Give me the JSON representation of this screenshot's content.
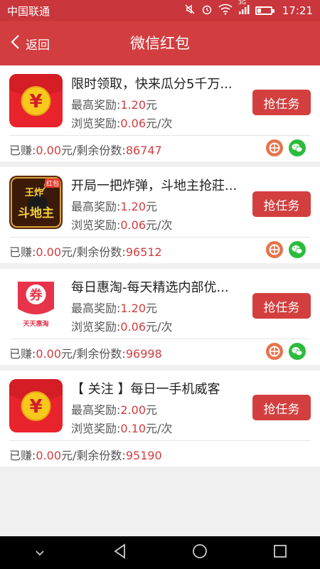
{
  "status_bar": {
    "carrier": "中国联通",
    "network": "3G",
    "time": "17:21"
  },
  "header": {
    "back_label": "返回",
    "title": "微信红包"
  },
  "tasks": [
    {
      "title": "限时领取，快来瓜分5千万...",
      "max_reward_label": "最高奖励:",
      "max_reward_value": "1.20",
      "max_reward_unit": "元",
      "view_reward_label": "浏览奖励:",
      "view_reward_value": "0.06",
      "view_reward_unit": "元/次",
      "earned_label": "已赚:",
      "earned_value": "0.00",
      "remaining_label": "元/剩余份数:",
      "remaining_value": "86747",
      "button_label": "抢任务",
      "icon": "yuan-coin-icon",
      "shares": true
    },
    {
      "title": "开局一把炸弹，斗地主抢莊...",
      "max_reward_label": "最高奖励:",
      "max_reward_value": "1.20",
      "max_reward_unit": "元",
      "view_reward_label": "浏览奖励:",
      "view_reward_value": "0.06",
      "view_reward_unit": "元/次",
      "earned_label": "已赚:",
      "earned_value": "0.00",
      "remaining_label": "元/剩余份数:",
      "remaining_value": "96512",
      "button_label": "抢任务",
      "icon": "doudizhu-game-icon",
      "logo_text": "王炸斗地主",
      "shares": true
    },
    {
      "title": "每日惠淘-每天精选内部优...",
      "max_reward_label": "最高奖励:",
      "max_reward_value": "1.20",
      "max_reward_unit": "元",
      "view_reward_label": "浏览奖励:",
      "view_reward_value": "0.06",
      "view_reward_unit": "元/次",
      "earned_label": "已赚:",
      "earned_value": "0.00",
      "remaining_label": "元/剩余份数:",
      "remaining_value": "96998",
      "button_label": "抢任务",
      "icon": "coupon-icon",
      "logo_text": "券 天天惠淘",
      "shares": true
    },
    {
      "title": "【 关注 】每日一手机威客",
      "max_reward_label": "最高奖励:",
      "max_reward_value": "2.00",
      "max_reward_unit": "元",
      "view_reward_label": "浏览奖励:",
      "view_reward_value": "0.10",
      "view_reward_unit": "元/次",
      "earned_label": "已赚:",
      "earned_value": "0.00",
      "remaining_label": "元/剩余份数:",
      "remaining_value": "95190",
      "button_label": "抢任务",
      "icon": "yuan-coin-icon",
      "shares": false
    }
  ],
  "colors": {
    "status_bar": "#c9363b",
    "title_bar": "#d23d3f",
    "accent": "#d23d3f",
    "button": "#d33f3f",
    "moments_icon": "#e8734a",
    "wechat_icon": "#2dbb3e"
  }
}
